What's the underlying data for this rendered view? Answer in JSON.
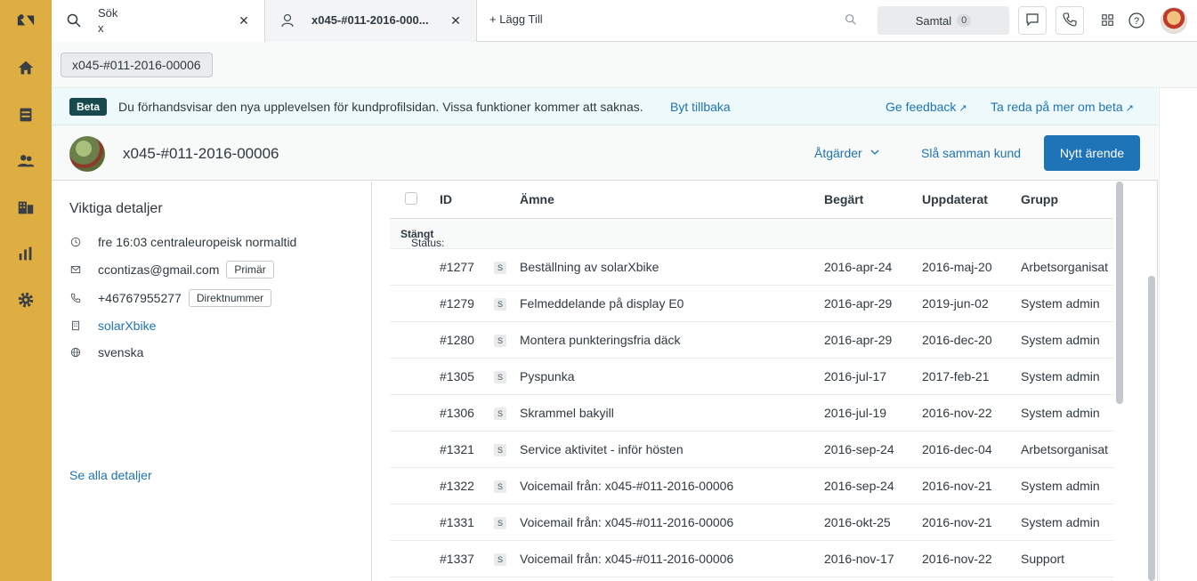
{
  "tabs": [
    {
      "title": "Sök",
      "subtitle": "x"
    },
    {
      "title": "x045-#011-2016-000..."
    }
  ],
  "add_tab_label": "+ Lägg Till",
  "samtal": {
    "label": "Samtal",
    "count": "0"
  },
  "breadcrumb": "x045-#011-2016-00006",
  "beta": {
    "badge": "Beta",
    "text": "Du förhandsvisar den nya upplevelsen för kundprofilsidan. Vissa funktioner kommer att saknas.",
    "back": "Byt tillbaka",
    "feedback": "Ge feedback",
    "more": "Ta reda på mer om beta"
  },
  "profile": {
    "name": "x045-#011-2016-00006",
    "actions": "Åtgärder",
    "merge": "Slå samman kund",
    "new_ticket": "Nytt ärende"
  },
  "details": {
    "title": "Viktiga detaljer",
    "time": "fre 16:03 centraleuropeisk normaltid",
    "email": "ccontizas@gmail.com",
    "email_tag": "Primär",
    "phone": "+46767955277",
    "phone_tag": "Direktnummer",
    "org": "solarXbike",
    "language": "svenska",
    "see_all": "Se alla detaljer"
  },
  "table": {
    "headers": {
      "id": "ID",
      "subject": "Ämne",
      "requested": "Begärt",
      "updated": "Uppdaterat",
      "group": "Grupp"
    },
    "status_label": "Status:",
    "status_value": "Stängt",
    "rows": [
      {
        "id": "#1277",
        "badge": "S",
        "subject": "Beställning av solarXbike",
        "requested": "2016-apr-24",
        "updated": "2016-maj-20",
        "group": "Arbetsorganisat"
      },
      {
        "id": "#1279",
        "badge": "S",
        "subject": "Felmeddelande på display E0",
        "requested": "2016-apr-29",
        "updated": "2019-jun-02",
        "group": "System admin"
      },
      {
        "id": "#1280",
        "badge": "S",
        "subject": "Montera punkteringsfria däck",
        "requested": "2016-apr-29",
        "updated": "2016-dec-20",
        "group": "System admin"
      },
      {
        "id": "#1305",
        "badge": "S",
        "subject": "Pyspunka",
        "requested": "2016-jul-17",
        "updated": "2017-feb-21",
        "group": "System admin"
      },
      {
        "id": "#1306",
        "badge": "S",
        "subject": "Skrammel bakyill",
        "requested": "2016-jul-19",
        "updated": "2016-nov-22",
        "group": "System admin"
      },
      {
        "id": "#1321",
        "badge": "S",
        "subject": "Service aktivitet - inför hösten",
        "requested": "2016-sep-24",
        "updated": "2016-dec-04",
        "group": "Arbetsorganisat"
      },
      {
        "id": "#1322",
        "badge": "S",
        "subject": "Voicemail från: x045-#011-2016-00006",
        "requested": "2016-sep-24",
        "updated": "2016-nov-21",
        "group": "System admin"
      },
      {
        "id": "#1331",
        "badge": "S",
        "subject": "Voicemail från: x045-#011-2016-00006",
        "requested": "2016-okt-25",
        "updated": "2016-nov-21",
        "group": "System admin"
      },
      {
        "id": "#1337",
        "badge": "S",
        "subject": "Voicemail från: x045-#011-2016-00006",
        "requested": "2016-nov-17",
        "updated": "2016-nov-22",
        "group": "Support"
      }
    ]
  },
  "colors": {
    "nav": "#dfae43",
    "accent": "#1f73b7",
    "beta_badge": "#17494d"
  }
}
